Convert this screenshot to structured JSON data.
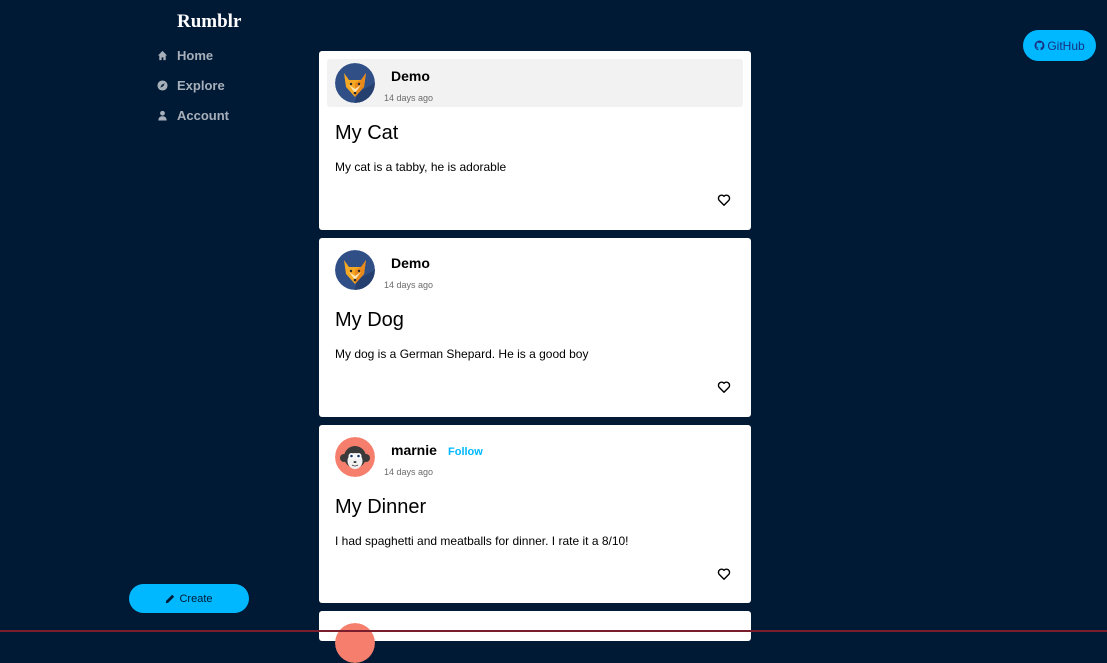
{
  "app": {
    "brand": "Rumblr"
  },
  "sidebar": {
    "items": [
      {
        "label": "Home",
        "icon": "home-icon"
      },
      {
        "label": "Explore",
        "icon": "compass-icon"
      },
      {
        "label": "Account",
        "icon": "user-icon"
      }
    ],
    "create_label": "Create"
  },
  "header": {
    "github_label": "GitHub"
  },
  "colors": {
    "background": "#001935",
    "accent": "#00b8ff",
    "card": "#ffffff"
  },
  "posts": [
    {
      "username": "Demo",
      "timestamp": "14 days ago",
      "title": "My Cat",
      "body": "My cat is a tabby, he is adorable",
      "avatar": "fox-avatar"
    },
    {
      "username": "Demo",
      "timestamp": "14 days ago",
      "title": "My Dog",
      "body": "My dog is a German Shepard. He is a good boy",
      "avatar": "fox-avatar"
    },
    {
      "username": "marnie",
      "follow_label": "Follow",
      "timestamp": "14 days ago",
      "title": "My Dinner",
      "body": "I had spaghetti and meatballs for dinner. I rate it a 8/10!",
      "avatar": "monkey-avatar"
    }
  ]
}
